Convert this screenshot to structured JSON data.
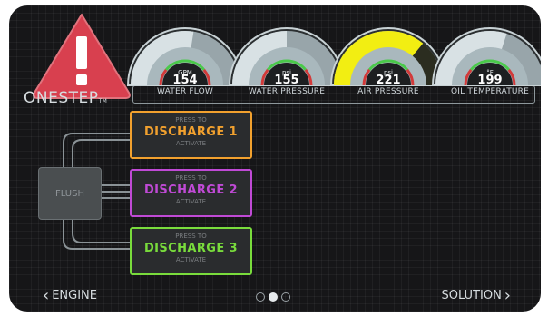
{
  "brand": {
    "name": "ONESTEP",
    "tm": "TM"
  },
  "gauges": [
    {
      "unit": "GPM",
      "value": "154",
      "label": "WATER FLOW",
      "level": 0.55,
      "highlight": false
    },
    {
      "unit": "psi",
      "value": "155",
      "label": "WATER PRESSURE",
      "level": 0.5,
      "highlight": false
    },
    {
      "unit": "psi",
      "value": "221",
      "label": "AIR PRESSURE",
      "level": 0.72,
      "highlight": true
    },
    {
      "unit": "°F",
      "value": "199",
      "label": "OIL TEMPERATURE",
      "level": 0.6,
      "highlight": false
    }
  ],
  "flush": {
    "label": "FLUSH"
  },
  "discharges": [
    {
      "press": "PRESS TO",
      "name": "DISCHARGE 1",
      "activate": "ACTIVATE",
      "color": "#f2a12e"
    },
    {
      "press": "PRESS TO",
      "name": "DISCHARGE 2",
      "activate": "ACTIVATE",
      "color": "#c04ad6"
    },
    {
      "press": "PRESS TO",
      "name": "DISCHARGE 3",
      "activate": "ACTIVATE",
      "color": "#79dc3c"
    }
  ],
  "nav": {
    "prev": "ENGINE",
    "next": "SOLUTION",
    "pages": 3,
    "current_page": 2
  },
  "colors": {
    "warning": "#d8404f",
    "gauge_face": "#a9b8bd",
    "gauge_highlight": "#f2ee12"
  }
}
